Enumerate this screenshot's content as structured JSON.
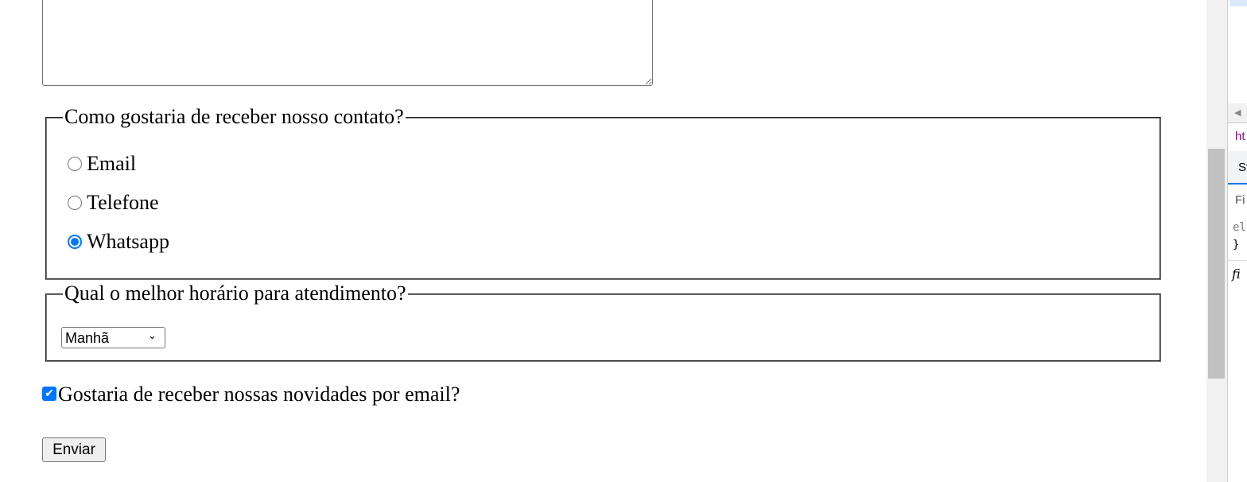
{
  "contact_fieldset": {
    "legend": "Como gostaria de receber nosso contato?",
    "options": [
      {
        "label": "Email",
        "checked": false
      },
      {
        "label": "Telefone",
        "checked": false
      },
      {
        "label": "Whatsapp",
        "checked": true
      }
    ]
  },
  "schedule_fieldset": {
    "legend": "Qual o melhor horário para atendimento?",
    "selected": "Manhã"
  },
  "newsletter": {
    "label": "Gostaria de receber nossas novidades por email?",
    "checked": true
  },
  "submit_label": "Enviar",
  "devtools": {
    "url_fragment": "ht",
    "tab_fragment": "St",
    "filter_fragment": "Fi",
    "code_line": "el",
    "brace": "}",
    "italic_fragment": "fi"
  },
  "colors": {
    "accent": "#0075ff",
    "border": "#767676"
  }
}
